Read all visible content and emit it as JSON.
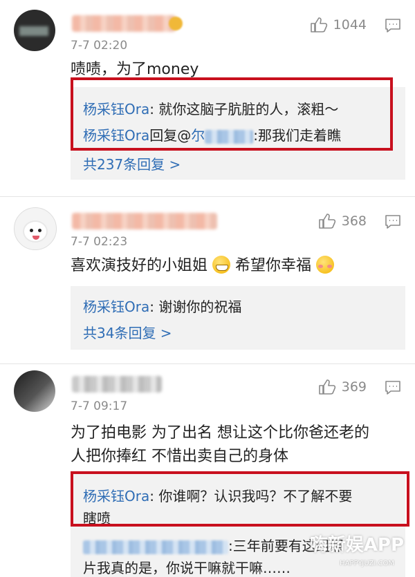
{
  "comments": [
    {
      "time": "7-7 02:20",
      "likes": "1044",
      "text": "啧啧，为了money",
      "replies": [
        {
          "name": "杨采钰Ora",
          "sep": ": ",
          "text": "就你这脑子肮脏的人，滚粗～"
        },
        {
          "name": "杨采钰Ora",
          "sep": "回复@",
          "mention": "尔",
          "text": ":那我们走着瞧"
        }
      ],
      "more": "共237条回复 >"
    },
    {
      "time": "7-7 02:23",
      "likes": "368",
      "text_a": "喜欢演技好的小姐姐",
      "text_b": "希望你幸福",
      "replies": [
        {
          "name": "杨采钰Ora",
          "sep": ": ",
          "text": "谢谢你的祝福"
        }
      ],
      "more": "共34条回复 >"
    },
    {
      "time": "7-7 09:17",
      "likes": "369",
      "text_line1": "为了拍电影 为了出名 想让这个比你爸还老的",
      "text_line2": "人把你捧红  不惜出卖自己的身体",
      "replies": [
        {
          "name": "杨采钰Ora",
          "sep": ": ",
          "text": "你谁啊？认识我吗？不了解不要",
          "text2": "瞎喷"
        },
        {
          "text": ":三年前要有这组照",
          "text2": "片我真的是，你说干嘛就干嘛……"
        }
      ]
    }
  ],
  "watermark": "嗨新娱APP",
  "watermark_sub": "HAPPYJUZI.COM",
  "colors": {
    "link": "#2f6db5",
    "highlight_box": "#c8101e",
    "reply_bg": "#f2f2f2"
  },
  "icons": [
    "thumbs-up-icon",
    "comment-icon"
  ]
}
